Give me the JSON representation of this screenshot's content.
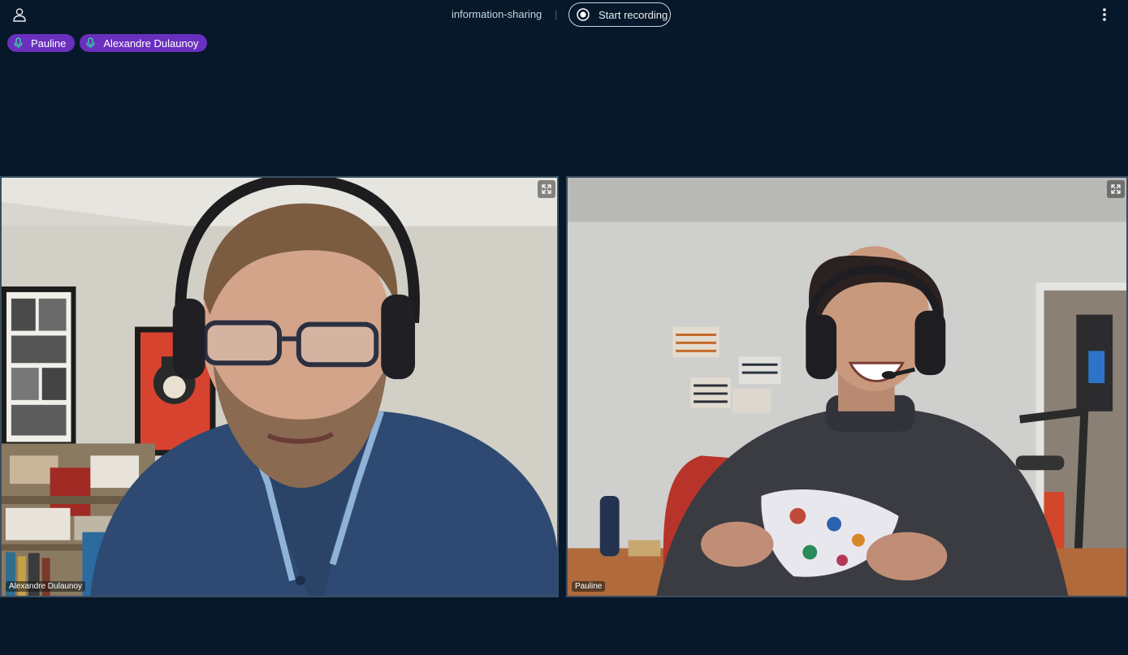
{
  "header": {
    "room_name": "information-sharing",
    "divider": "|",
    "record_label": "Start recording"
  },
  "participants": [
    {
      "name": "Pauline"
    },
    {
      "name": "Alexandre Dulaunoy"
    }
  ],
  "tiles": [
    {
      "name": "Alexandre Dulaunoy"
    },
    {
      "name": "Pauline"
    }
  ],
  "colors": {
    "background": "#06182a",
    "pill": "#6a2fbf",
    "mic": "#37d6a6"
  },
  "icons": {
    "user": "user-icon",
    "record": "record-icon",
    "more": "more-vertical-icon",
    "mic": "microphone-icon",
    "expand": "fullscreen-icon"
  }
}
